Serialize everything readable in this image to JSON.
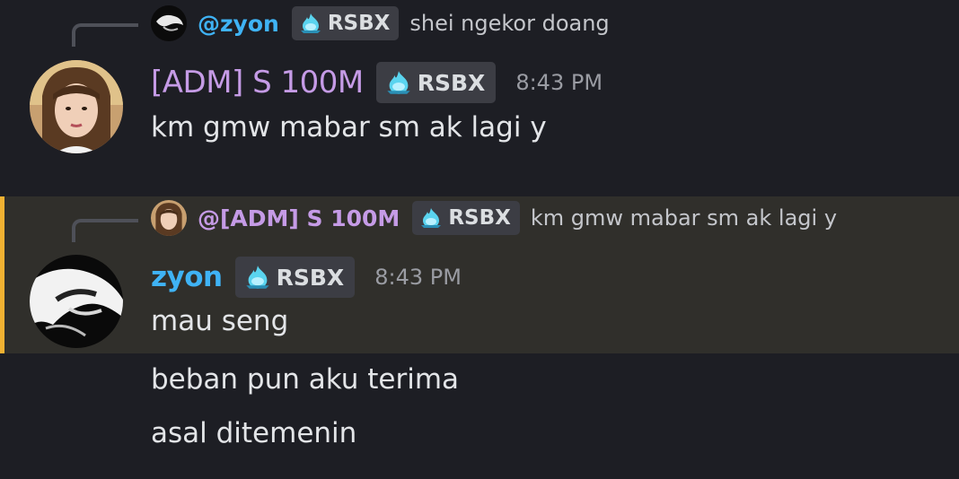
{
  "colors": {
    "adm_name": "#c59be6",
    "zyon_name": "#3fb3f5",
    "mention_bar": "#f0b132",
    "badge_bg": "#3c3d44",
    "timestamp": "#9a9ca3"
  },
  "messages": [
    {
      "reply": {
        "author": "@zyon",
        "badge": "RSBX",
        "text": "shei ngekor doang"
      },
      "author": "[ADM] S 100M",
      "badge": "RSBX",
      "timestamp": "8:43 PM",
      "lines": [
        "km gmw mabar sm ak lagi y"
      ]
    },
    {
      "highlighted": true,
      "reply": {
        "author": "@[ADM] S 100M",
        "badge": "RSBX",
        "text": "km gmw mabar sm ak lagi y"
      },
      "author": "zyon",
      "badge": "RSBX",
      "timestamp": "8:43 PM",
      "lines": [
        "mau seng"
      ]
    }
  ],
  "followups": [
    "beban pun aku terima",
    "asal ditemenin"
  ],
  "icons": {
    "badge_icon": "water-drop-flame-icon",
    "avatar_adm": "avatar-girl",
    "avatar_zyon": "avatar-bw"
  }
}
